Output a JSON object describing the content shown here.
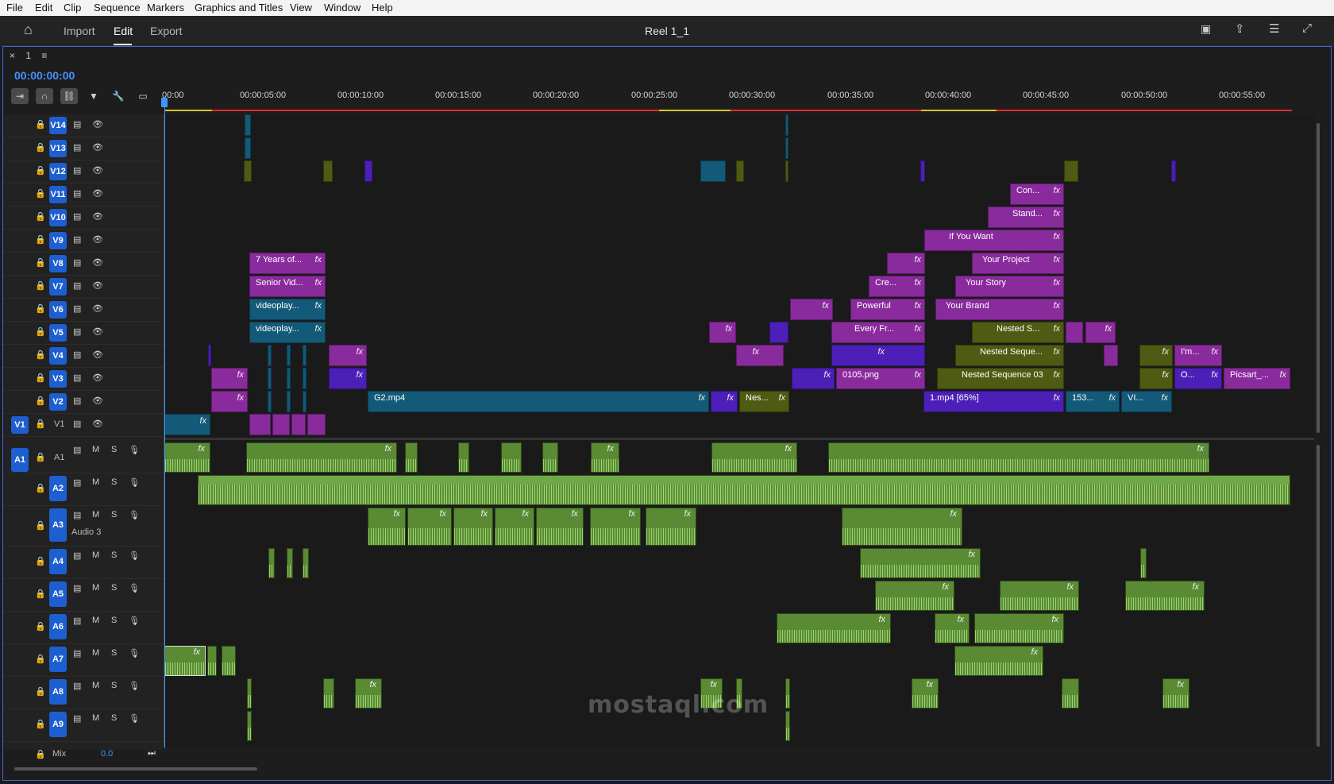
{
  "menu": [
    "File",
    "Edit",
    "Clip",
    "Sequence",
    "Markers",
    "Graphics and Titles",
    "View",
    "Window",
    "Help"
  ],
  "workspaces": {
    "import": "Import",
    "edit": "Edit",
    "export": "Export"
  },
  "sequence_title": "Reel 1_1",
  "tab": {
    "close": "×",
    "name": "1",
    "menu": "≡"
  },
  "timecode": "00:00:00:00",
  "ruler": [
    "00:00",
    "00:00:05:00",
    "00:00:10:00",
    "00:00:15:00",
    "00:00:20:00",
    "00:00:25:00",
    "00:00:30:00",
    "00:00:35:00",
    "00:00:40:00",
    "00:00:45:00",
    "00:00:50:00",
    "00:00:55:00"
  ],
  "video_tracks": [
    "V14",
    "V13",
    "V12",
    "V11",
    "V10",
    "V9",
    "V8",
    "V7",
    "V6",
    "V5",
    "V4",
    "V3",
    "V2",
    "V1"
  ],
  "audio_tracks": [
    "A1",
    "A2",
    "A3",
    "A4",
    "A5",
    "A6",
    "A7",
    "A8",
    "A9"
  ],
  "source_patch": {
    "v1": "V1",
    "a1": "A1"
  },
  "audio3_name": "Audio 3",
  "mix": {
    "label": "Mix",
    "value": "0.0"
  },
  "clips": {
    "v11_con": "Con...",
    "v10_stand": "Stand...",
    "v9_ifyouwant": "If You Want",
    "v8_7years": "7 Years of...",
    "v8_yourproject": "Your Project",
    "v7_senior": "Senior Vid...",
    "v7_cre": "Cre...",
    "v7_yourstory": "Your Story",
    "v6_videoplay": "videoplay...",
    "v6_powerful": "Powerful",
    "v6_yourbrand": "Your Brand",
    "v5_videoplay": "videoplay...",
    "v5_everyfr": "Every Fr...",
    "v5_nesteds": "Nested S...",
    "v4_nestedseque": "Nested Seque...",
    "v4_im": "I'm...",
    "v3_0105": "0105.png",
    "v3_nested03": "Nested Sequence 03",
    "v3_o": "O...",
    "v3_picsart": "Picsart_...",
    "v2_g2": "G2.mp4",
    "v2_nes": "Nes...",
    "v2_1mp4": "1.mp4 [65%]",
    "v2_153": "153...",
    "v2_vi": "VI..."
  },
  "fx_label": "fx",
  "watermark": "mostaql.com",
  "colors": {
    "accent": "#3e95ff",
    "purple": "#8a2b9d",
    "teal": "#125a78",
    "olive": "#4f5a12",
    "violet": "#4b1fb8",
    "audio": "#5a8a34"
  }
}
